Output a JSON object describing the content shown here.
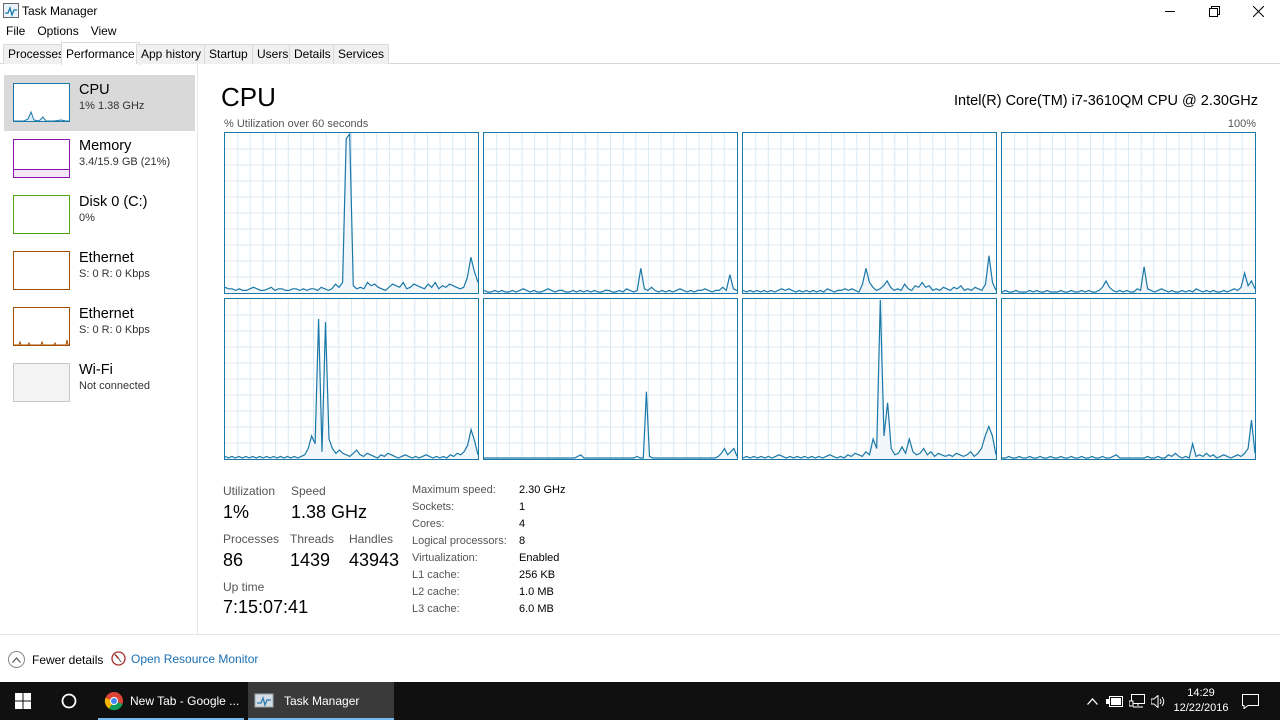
{
  "window": {
    "title": "Task Manager"
  },
  "menu": [
    "File",
    "Options",
    "View"
  ],
  "tabs": [
    "Processes",
    "Performance",
    "App history",
    "Startup",
    "Users",
    "Details",
    "Services"
  ],
  "active_tab": "Performance",
  "sidebar": [
    {
      "name": "CPU",
      "sub": "1% 1.38 GHz",
      "color": "#1a78a8"
    },
    {
      "name": "Memory",
      "sub": "3.4/15.9 GB (21%)",
      "color": "#8b12ae"
    },
    {
      "name": "Disk 0 (C:)",
      "sub": "0%",
      "color": "#4da60c"
    },
    {
      "name": "Ethernet",
      "sub": "S: 0 R: 0 Kbps",
      "color": "#a74f01"
    },
    {
      "name": "Ethernet",
      "sub": "S: 0 R: 0 Kbps",
      "color": "#a74f01"
    },
    {
      "name": "Wi-Fi",
      "sub": "Not connected",
      "color": "#c8c8c8"
    }
  ],
  "main": {
    "title": "CPU",
    "model": "Intel(R) Core(TM) i7-3610QM CPU @ 2.30GHz",
    "graph_caption": "% Utilization over 60 seconds",
    "graph_max": "100%",
    "graph_color": "#1a78a8",
    "graph_fill": "#f1f6fa"
  },
  "chart_data": {
    "type": "area",
    "title": "",
    "xlabel": "% Utilization over 60 seconds",
    "ylabel": "",
    "ylim": [
      0,
      100
    ],
    "grid": true,
    "legend": "none",
    "series": [
      {
        "values": [
          3,
          2,
          2,
          1,
          2,
          1,
          1,
          2,
          3,
          2,
          1,
          1,
          2,
          3,
          1,
          2,
          2,
          1,
          1,
          2,
          2,
          1,
          2,
          1,
          2,
          2,
          1,
          3,
          2,
          1,
          2,
          5,
          3,
          6,
          97,
          100,
          4,
          2,
          3,
          2,
          6,
          4,
          5,
          3,
          2,
          1,
          3,
          5,
          4,
          3,
          6,
          2,
          3,
          5,
          4,
          3,
          2,
          5,
          3,
          6,
          2,
          4,
          3,
          5,
          4,
          3,
          2,
          3,
          9,
          22,
          13,
          6
        ]
      },
      {
        "values": [
          1,
          0,
          0,
          1,
          0,
          1,
          0,
          0,
          1,
          0,
          1,
          2,
          1,
          0,
          1,
          0,
          0,
          1,
          2,
          1,
          0,
          1,
          1,
          0,
          0,
          1,
          0,
          1,
          0,
          1,
          0,
          1,
          0,
          0,
          1,
          1,
          0,
          0,
          1,
          0,
          2,
          1,
          0,
          1,
          15,
          2,
          1,
          3,
          1,
          0,
          1,
          0,
          1,
          0,
          1,
          2,
          1,
          0,
          1,
          0,
          1,
          1,
          2,
          1,
          0,
          1,
          1,
          3,
          1,
          11,
          2,
          1
        ]
      },
      {
        "values": [
          1,
          0,
          1,
          0,
          1,
          0,
          1,
          0,
          1,
          0,
          1,
          2,
          1,
          2,
          1,
          0,
          1,
          0,
          1,
          0,
          1,
          0,
          1,
          0,
          2,
          1,
          0,
          1,
          1,
          2,
          1,
          2,
          1,
          0,
          5,
          15,
          6,
          3,
          1,
          2,
          4,
          7,
          3,
          1,
          2,
          1,
          5,
          2,
          1,
          4,
          3,
          6,
          3,
          4,
          1,
          2,
          1,
          3,
          2,
          1,
          3,
          2,
          4,
          1,
          2,
          1,
          3,
          2,
          1,
          5,
          23,
          6,
          1
        ]
      },
      {
        "values": [
          0,
          1,
          0,
          0,
          1,
          0,
          0,
          0,
          1,
          0,
          1,
          0,
          0,
          1,
          0,
          0,
          0,
          1,
          0,
          0,
          1,
          0,
          0,
          1,
          0,
          1,
          0,
          0,
          1,
          3,
          7,
          3,
          1,
          0,
          1,
          0,
          1,
          0,
          0,
          2,
          1,
          16,
          2,
          1,
          0,
          1,
          2,
          1,
          0,
          1,
          0,
          0,
          1,
          0,
          1,
          0,
          2,
          1,
          0,
          1,
          0,
          1,
          0,
          0,
          1,
          0,
          1,
          2,
          1,
          3,
          12,
          4,
          7,
          2
        ]
      },
      {
        "values": [
          1,
          0,
          1,
          0,
          1,
          0,
          1,
          0,
          1,
          0,
          1,
          0,
          1,
          0,
          1,
          0,
          1,
          0,
          1,
          0,
          1,
          0,
          1,
          2,
          6,
          14,
          9,
          88,
          4,
          86,
          12,
          6,
          3,
          5,
          3,
          2,
          1,
          3,
          5,
          2,
          1,
          3,
          2,
          1,
          0,
          2,
          1,
          3,
          2,
          1,
          0,
          1,
          2,
          1,
          0,
          1,
          0,
          1,
          2,
          1,
          0,
          1,
          0,
          1,
          0,
          2,
          1,
          3,
          2,
          4,
          8,
          18,
          11,
          2
        ]
      },
      {
        "values": [
          0,
          0,
          0,
          0,
          0,
          0,
          0,
          0,
          0,
          0,
          0,
          0,
          0,
          0,
          0,
          0,
          0,
          0,
          0,
          0,
          0,
          0,
          0,
          0,
          0,
          0,
          0,
          0,
          0,
          0,
          1,
          2,
          0,
          0,
          0,
          0,
          0,
          0,
          0,
          0,
          0,
          0,
          0,
          0,
          0,
          0,
          0,
          0,
          0,
          1,
          0,
          0,
          42,
          1,
          0,
          0,
          0,
          0,
          0,
          0,
          0,
          0,
          0,
          0,
          0,
          0,
          0,
          0,
          0,
          0,
          0,
          0,
          0,
          0,
          0,
          1,
          3,
          6,
          2,
          4,
          6,
          1
        ]
      },
      {
        "values": [
          0,
          1,
          0,
          1,
          0,
          1,
          0,
          1,
          0,
          1,
          2,
          1,
          0,
          1,
          0,
          1,
          0,
          1,
          0,
          1,
          0,
          1,
          0,
          1,
          2,
          1,
          0,
          1,
          0,
          2,
          1,
          3,
          2,
          1,
          4,
          2,
          12,
          6,
          100,
          14,
          35,
          6,
          2,
          3,
          7,
          3,
          12,
          4,
          2,
          3,
          6,
          2,
          4,
          1,
          3,
          2,
          1,
          2,
          1,
          3,
          2,
          1,
          2,
          4,
          1,
          3,
          6,
          14,
          20,
          14,
          2
        ]
      },
      {
        "values": [
          0,
          0,
          1,
          0,
          0,
          1,
          0,
          0,
          1,
          0,
          0,
          1,
          0,
          0,
          1,
          0,
          0,
          1,
          0,
          0,
          1,
          0,
          0,
          1,
          0,
          0,
          1,
          0,
          0,
          1,
          0,
          0,
          1,
          2,
          0,
          0,
          0,
          0,
          0,
          0,
          0,
          0,
          1,
          0,
          0,
          1,
          0,
          0,
          2,
          1,
          3,
          1,
          0,
          1,
          0,
          9,
          1,
          2,
          1,
          3,
          1,
          2,
          0,
          1,
          2,
          1,
          0,
          1,
          2,
          1,
          3,
          6,
          24,
          3
        ]
      }
    ]
  },
  "stats": {
    "utilization_label": "Utilization",
    "utilization": "1%",
    "speed_label": "Speed",
    "speed": "1.38 GHz",
    "processes_label": "Processes",
    "processes": "86",
    "threads_label": "Threads",
    "threads": "1439",
    "handles_label": "Handles",
    "handles": "43943",
    "uptime_label": "Up time",
    "uptime": "7:15:07:41"
  },
  "specs": [
    {
      "k": "Maximum speed:",
      "v": "2.30 GHz"
    },
    {
      "k": "Sockets:",
      "v": "1"
    },
    {
      "k": "Cores:",
      "v": "4"
    },
    {
      "k": "Logical processors:",
      "v": "8"
    },
    {
      "k": "Virtualization:",
      "v": "Enabled"
    },
    {
      "k": "L1 cache:",
      "v": "256 KB"
    },
    {
      "k": "L2 cache:",
      "v": "1.0 MB"
    },
    {
      "k": "L3 cache:",
      "v": "6.0 MB"
    }
  ],
  "footer": {
    "fewer": "Fewer details",
    "resmon": "Open Resource Monitor"
  },
  "taskbar": {
    "apps": [
      "New Tab - Google ...",
      "Task Manager"
    ],
    "time": "14:29",
    "date": "12/22/2016",
    "icons": [
      "windows-logo-icon",
      "cortana-icon",
      "chrome-icon",
      "task-manager-icon",
      "chevron-up-icon",
      "battery-icon",
      "network-icon",
      "volume-icon",
      "notification-icon"
    ]
  }
}
